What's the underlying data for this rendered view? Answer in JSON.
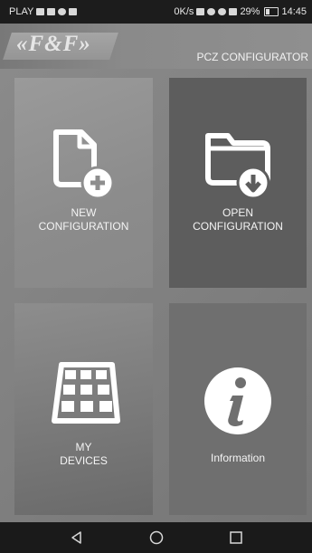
{
  "status_bar": {
    "carrier": "PLAY",
    "net_speed": "0K/s",
    "battery": "29%",
    "time": "14:45",
    "icons": [
      "sim-icon",
      "message-icon",
      "facebook-icon",
      "gallery-icon",
      "nfc-icon",
      "alarm-icon",
      "wifi-icon",
      "signal-icon",
      "battery-icon"
    ]
  },
  "header": {
    "logo_text": "«F&F»",
    "title": "PCZ CONFIGURATOR"
  },
  "tiles": {
    "new_configuration": {
      "line1": "NEW",
      "line2": "CONFIGURATION",
      "icon": "new-file-icon"
    },
    "open_configuration": {
      "line1": "OPEN",
      "line2": "CONFIGURATION",
      "icon": "open-folder-icon"
    },
    "my_devices": {
      "line1": "MY",
      "line2": "DEVICES",
      "icon": "device-grid-icon"
    },
    "information": {
      "label": "Information",
      "icon": "info-icon"
    }
  },
  "nav_bar": {
    "buttons": [
      "back-icon",
      "home-icon",
      "recents-icon"
    ]
  },
  "colors": {
    "status_bar_bg": "#1c1c1c",
    "tile_open_bg": "#5d5d5d",
    "nav_bar_bg": "#1a1a1a",
    "text": "#f4f4f4"
  }
}
